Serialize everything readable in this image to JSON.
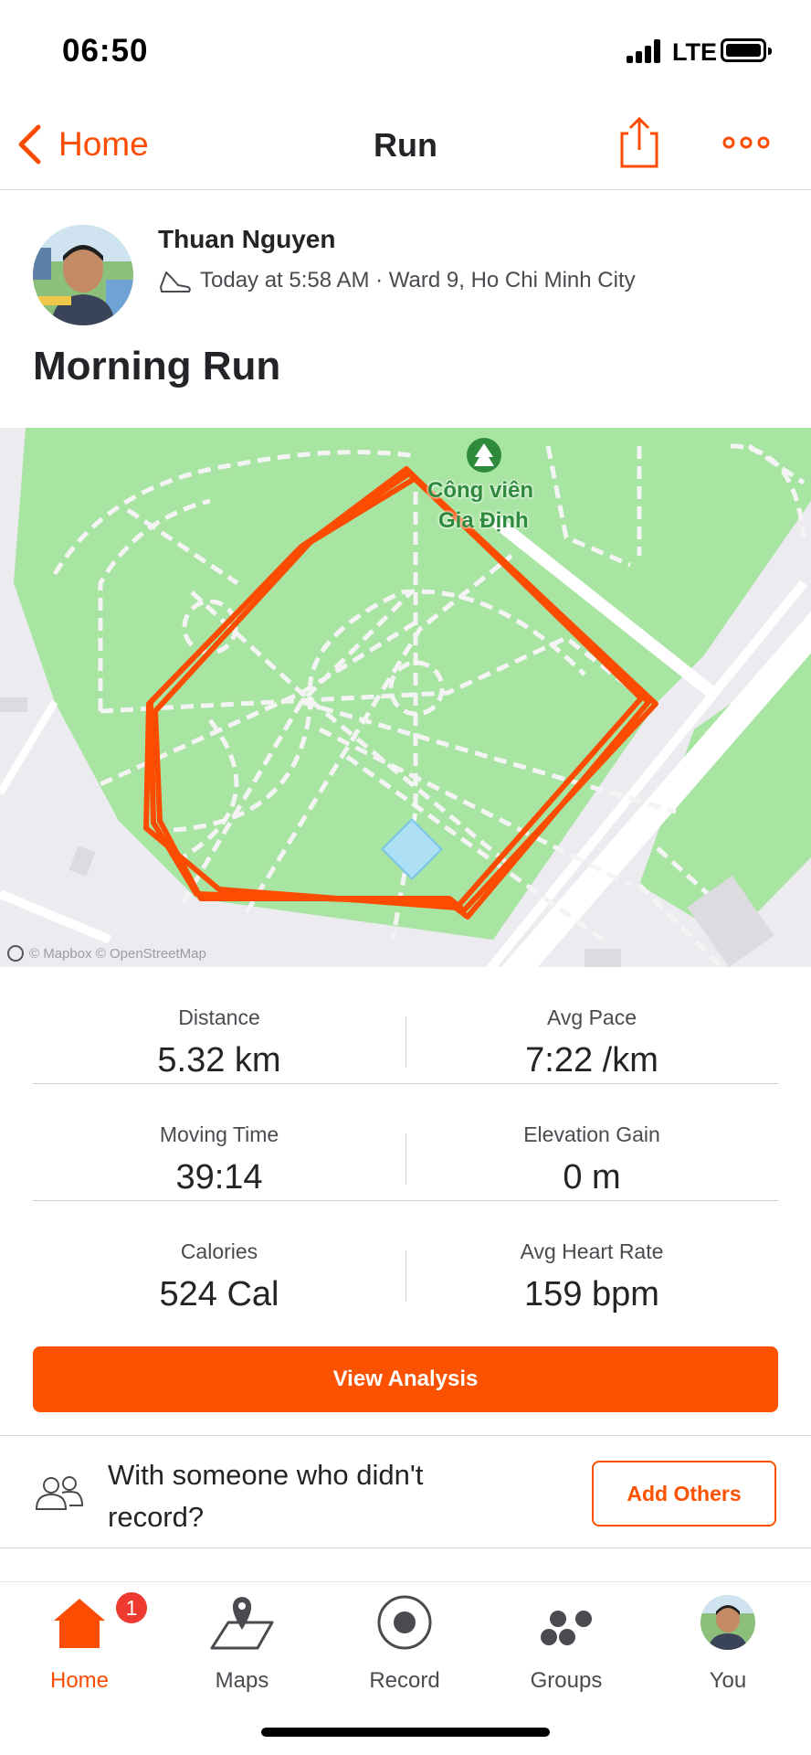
{
  "status_bar": {
    "time": "06:50",
    "network": "LTE"
  },
  "nav": {
    "back_label": "Home",
    "title": "Run"
  },
  "athlete": {
    "name": "Thuan Nguyen",
    "meta": "Today at 5:58 AM · Ward 9, Ho Chi Minh City",
    "activity_title": "Morning Run"
  },
  "map": {
    "place_label_line1": "Công viên",
    "place_label_line2": "Gia Định",
    "attribution": "© Mapbox © OpenStreetMap",
    "route_color": "#fc4c02"
  },
  "stats": [
    {
      "label": "Distance",
      "value": "5.32 km"
    },
    {
      "label": "Avg Pace",
      "value": "7:22 /km"
    },
    {
      "label": "Moving Time",
      "value": "39:14"
    },
    {
      "label": "Elevation Gain",
      "value": "0 m"
    },
    {
      "label": "Calories",
      "value": "524 Cal"
    },
    {
      "label": "Avg Heart Rate",
      "value": "159 bpm"
    }
  ],
  "analysis_button": "View Analysis",
  "with_others": {
    "text": "With someone who didn't record?",
    "button": "Add Others"
  },
  "tabbar": {
    "home": "Home",
    "home_badge": "1",
    "maps": "Maps",
    "record": "Record",
    "groups": "Groups",
    "you": "You"
  },
  "colors": {
    "accent": "#fc4c02",
    "button": "#fc5200",
    "park": "#a8e4a2"
  }
}
